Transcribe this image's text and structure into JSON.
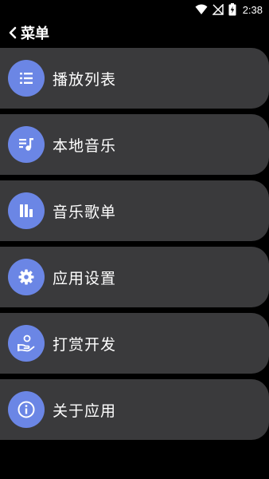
{
  "status_bar": {
    "time": "2:38",
    "icons": [
      "wifi-icon",
      "no-signal-icon",
      "battery-charging-icon"
    ]
  },
  "header": {
    "back_icon": "chevron-left-icon",
    "title": "菜单"
  },
  "menu": {
    "items": [
      {
        "label": "播放列表",
        "icon": "playlist-icon"
      },
      {
        "label": "本地音乐",
        "icon": "local-music-icon"
      },
      {
        "label": "音乐歌单",
        "icon": "library-icon"
      },
      {
        "label": "应用设置",
        "icon": "gear-icon"
      },
      {
        "label": "打赏开发",
        "icon": "donate-hand-icon"
      },
      {
        "label": "关于应用",
        "icon": "info-icon"
      }
    ]
  },
  "colors": {
    "background": "#000000",
    "card": "#3a3a3c",
    "icon_circle": "#6b86e5",
    "text": "#ffffff"
  }
}
